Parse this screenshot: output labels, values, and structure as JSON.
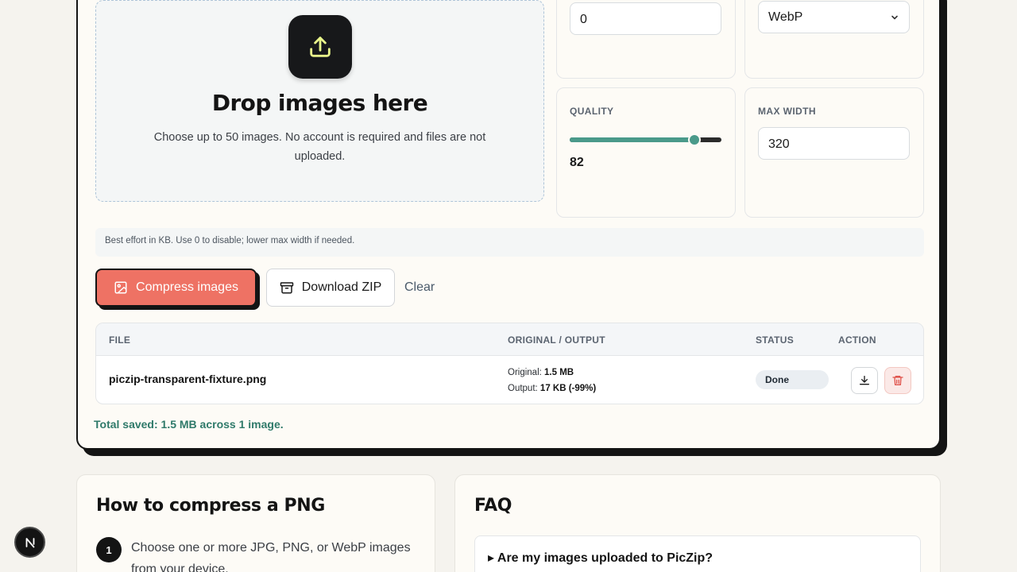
{
  "dropzone": {
    "title": "Drop images here",
    "description": "Choose up to 50 images. No account is required and files are not uploaded."
  },
  "settings": {
    "target_size": {
      "value": "0"
    },
    "format": {
      "selected": "WebP"
    },
    "quality": {
      "label": "QUALITY",
      "value": "82",
      "percent": 82
    },
    "max_width": {
      "label": "MAX WIDTH",
      "value": "320"
    }
  },
  "hint": "Best effort in KB. Use 0 to disable; lower max width if needed.",
  "actions": {
    "compress_label": "Compress images",
    "zip_label": "Download ZIP",
    "clear_label": "Clear"
  },
  "table": {
    "headers": [
      "FILE",
      "ORIGINAL / OUTPUT",
      "STATUS",
      "ACTION"
    ],
    "rows": [
      {
        "file": "piczip-transparent-fixture.png",
        "original_label": "Original:",
        "original": "1.5 MB",
        "output_label": "Output:",
        "output": "17 KB (-99%)",
        "status": "Done"
      }
    ]
  },
  "total_saved": "Total saved: 1.5 MB across 1 image.",
  "how_to": {
    "title": "How to compress a PNG",
    "steps": [
      {
        "num": "1",
        "text": "Choose one or more JPG, PNG, or WebP images from your device."
      }
    ]
  },
  "faq": {
    "title": "FAQ",
    "items": [
      {
        "question": "▸ Are my images uploaded to PicZip?"
      }
    ]
  },
  "dev_badge": "N",
  "colors": {
    "accent": "#ee7264",
    "teal": "#4a9a8a",
    "success_text": "#2f7a6a",
    "ink": "#141414"
  }
}
